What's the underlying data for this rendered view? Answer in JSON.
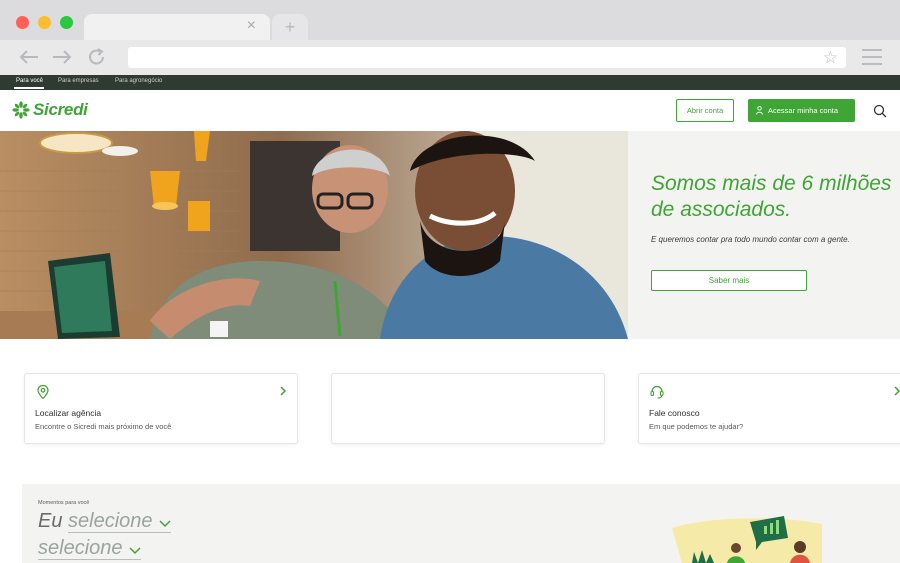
{
  "browser": {
    "tab_close": "×",
    "new_tab": "+",
    "back_icon": "arrow-left",
    "forward_icon": "arrow-right",
    "reload_icon": "reload",
    "bookmark_icon": "star",
    "menu_icon": "hamburger"
  },
  "topstrip": {
    "items": [
      "Para você",
      "Para empresas",
      "Para agronegócio"
    ]
  },
  "header": {
    "logo_text": "Sicredi",
    "open_account": "Abrir conta",
    "access_account": "Acessar minha conta"
  },
  "hero": {
    "title": "Somos mais de 6 milhões de associados.",
    "subtitle": "E queremos contar pra todo mundo contar com a gente.",
    "cta": "Saber mais"
  },
  "cards": [
    {
      "title": "Localizar agência",
      "desc": "Encontre o Sicredi mais próximo de você",
      "icon": "location-pin-icon"
    },
    {
      "title": "",
      "desc": "",
      "icon": ""
    },
    {
      "title": "Fale conosco",
      "desc": "Em que podemos te ajudar?",
      "icon": "chat-headset-icon"
    }
  ],
  "moments": {
    "label": "Momentos para você",
    "row1_prefix": "Eu",
    "row1_select": "selecione",
    "row2_select": "selecione"
  },
  "colors": {
    "brand_green": "#3fa535",
    "top_strip": "#2f3a33",
    "panel_bg": "#f3f3f1"
  }
}
